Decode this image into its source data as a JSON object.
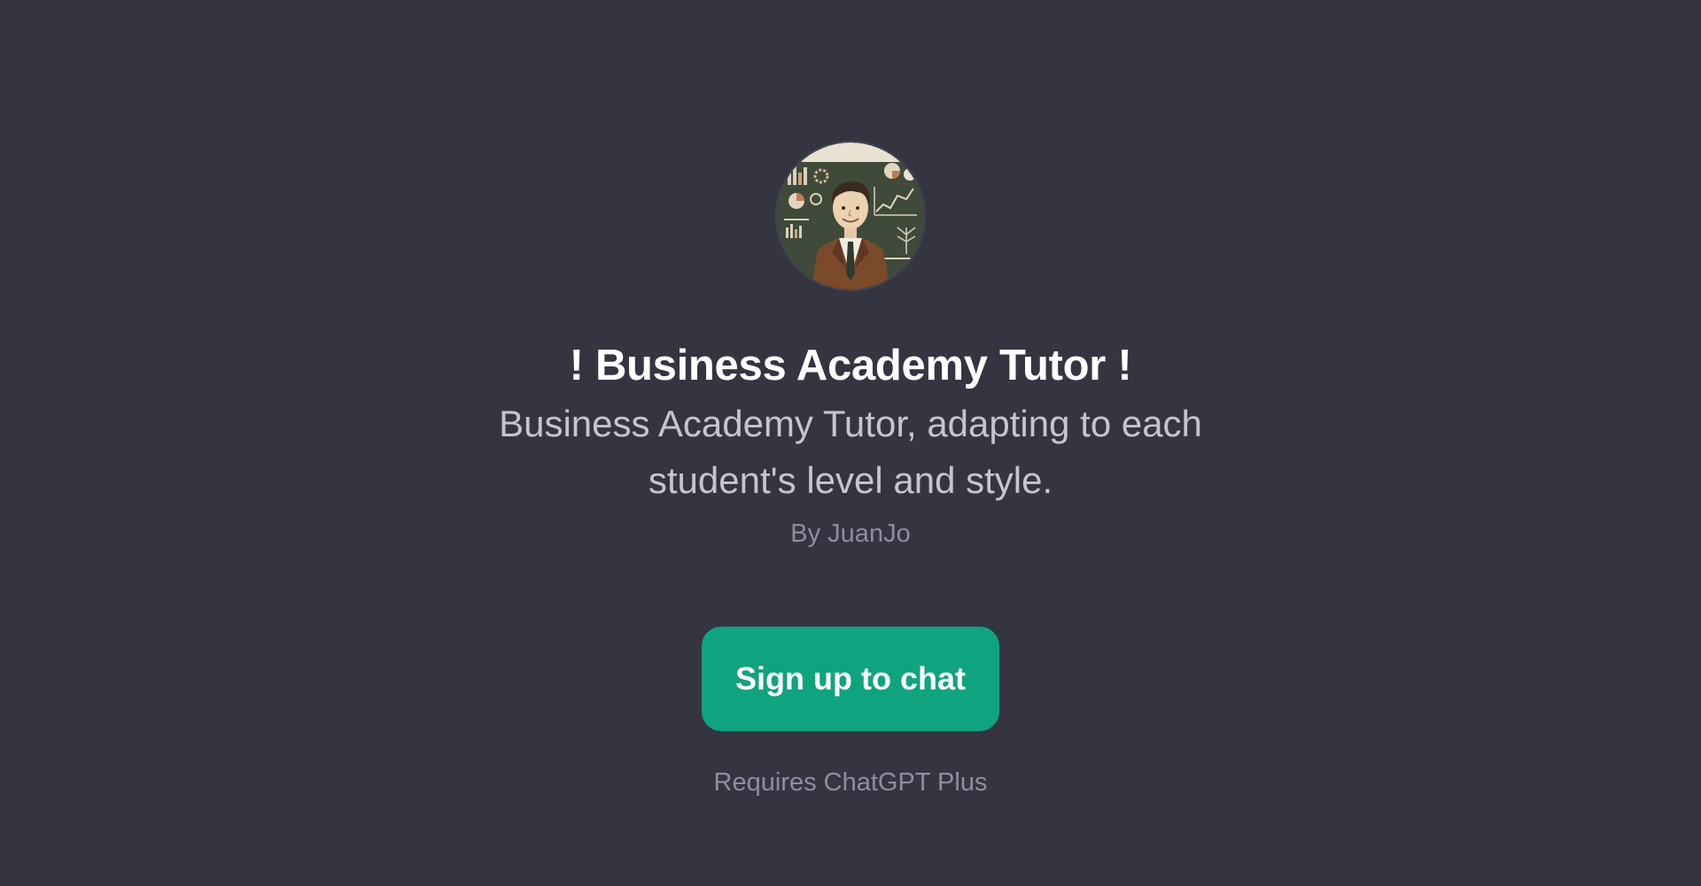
{
  "gpt": {
    "avatar_icon": "business-tutor-avatar-icon",
    "title": "! Business Academy Tutor !",
    "description": "Business Academy Tutor, adapting to each student's level and style.",
    "author": "By JuanJo"
  },
  "actions": {
    "signup_label": "Sign up to chat",
    "requirement_note": "Requires ChatGPT Plus"
  },
  "colors": {
    "background": "#343541",
    "accent": "#10a37f",
    "title": "#ffffff",
    "description": "#c5c5d2",
    "muted": "#8e8ea0"
  }
}
